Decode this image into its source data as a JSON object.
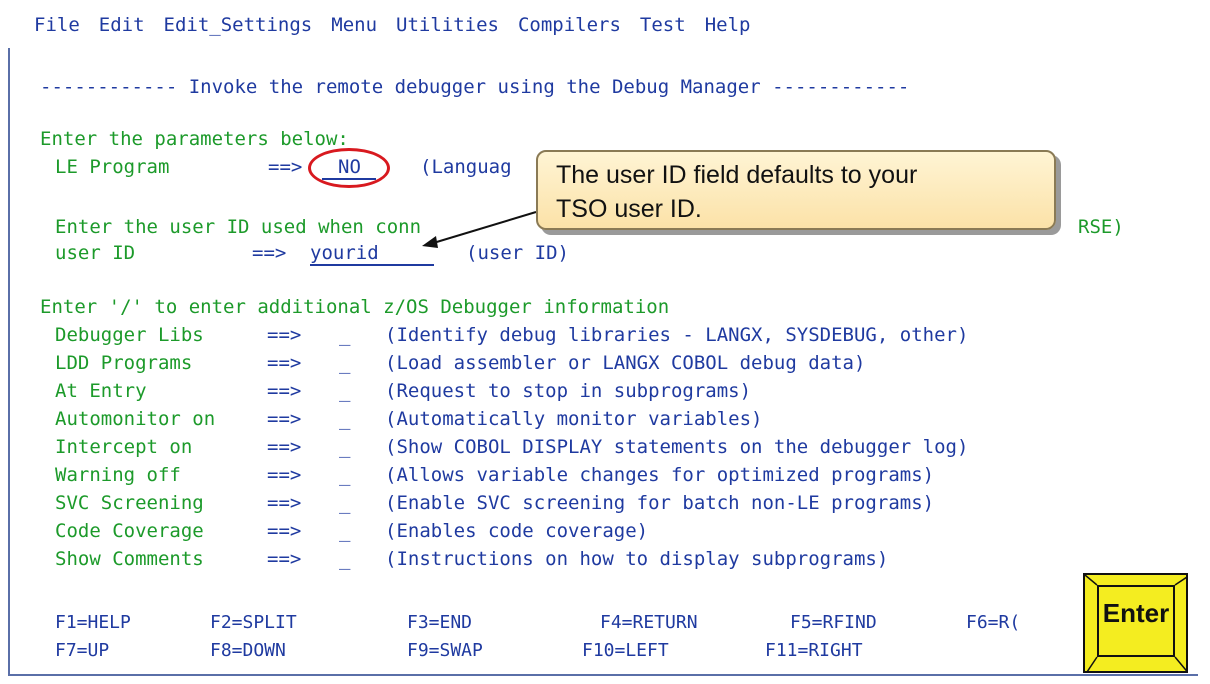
{
  "menu": [
    "File",
    "Edit",
    "Edit_Settings",
    "Menu",
    "Utilities",
    "Compilers",
    "Test",
    "Help"
  ],
  "panel": {
    "title": "------------ Invoke the remote debugger using the Debug Manager ------------",
    "enter_params": "Enter the parameters below:",
    "le_program_label": "LE Program",
    "le_program_arrow": "==>",
    "le_program_value": "NO",
    "le_program_hint": "(Languag",
    "userid_prompt": "Enter the user ID used when conn",
    "userid_prompt_tail": "RSE)",
    "userid_label": "user ID",
    "userid_arrow": "==>",
    "userid_value": "yourid",
    "userid_hint": "(user ID)",
    "additional": "Enter '/' to enter additional z/OS Debugger information",
    "options": [
      {
        "label": "Debugger Libs ",
        "arrow": "==>",
        "value": "_",
        "desc": "(Identify debug libraries - LANGX, SYSDEBUG, other)"
      },
      {
        "label": "LDD Programs  ",
        "arrow": "==>",
        "value": "_",
        "desc": "(Load assembler or LANGX COBOL debug data)"
      },
      {
        "label": "At Entry      ",
        "arrow": "==>",
        "value": "_",
        "desc": "(Request to stop in subprograms)"
      },
      {
        "label": "Automonitor on",
        "arrow": "==>",
        "value": "_",
        "desc": "(Automatically monitor variables)"
      },
      {
        "label": "Intercept on  ",
        "arrow": "==>",
        "value": "_",
        "desc": "(Show COBOL DISPLAY statements on the debugger log)"
      },
      {
        "label": "Warning off   ",
        "arrow": "==>",
        "value": "_",
        "desc": "(Allows variable changes for optimized programs)"
      },
      {
        "label": "SVC Screening ",
        "arrow": "==>",
        "value": "_",
        "desc": "(Enable SVC screening for batch non-LE programs)"
      },
      {
        "label": "Code Coverage ",
        "arrow": "==>",
        "value": "_",
        "desc": "(Enables code coverage)"
      },
      {
        "label": "Show Comments ",
        "arrow": "==>",
        "value": "_",
        "desc": "(Instructions on how to display subprograms)"
      }
    ],
    "fkeys_row1": [
      "F1=HELP",
      "F2=SPLIT",
      "F3=END",
      "F4=RETURN",
      "F5=RFIND",
      "F6=R("
    ],
    "fkeys_row2": [
      "F7=UP",
      "F8=DOWN",
      "F9=SWAP",
      "F10=LEFT",
      "F11=RIGHT"
    ]
  },
  "callout": {
    "line1": "The user ID field defaults to your",
    "line2": "TSO user ID."
  },
  "enter_key": {
    "label": "Enter",
    "color": "#f4ed20"
  },
  "colors": {
    "field_text": "#1f3aa0",
    "prompt_text": "#1c9a2a",
    "highlight_circle": "#d8191f"
  }
}
